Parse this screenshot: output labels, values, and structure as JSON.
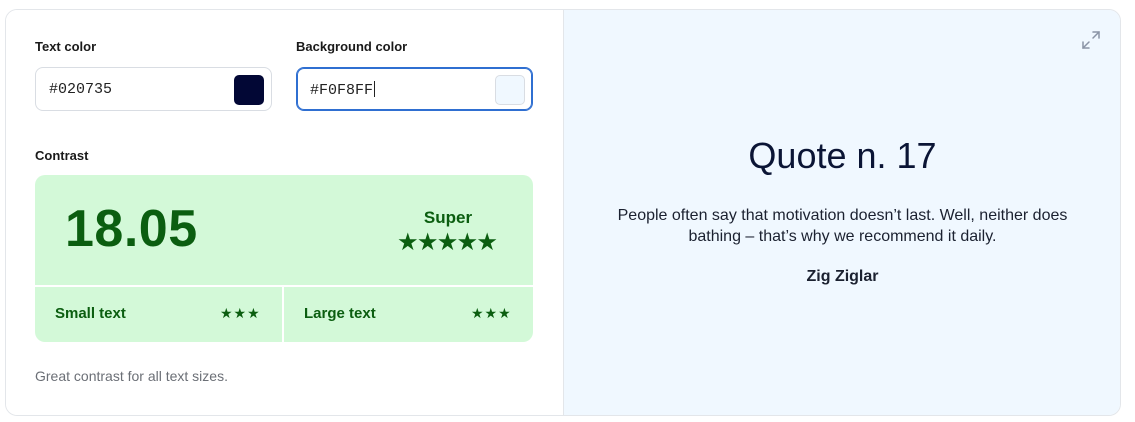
{
  "text_color": {
    "label": "Text color",
    "value": "#020735",
    "swatch": "#020735"
  },
  "background_color": {
    "label": "Background color",
    "value": "#F0F8FF",
    "swatch": "#F0F8FF"
  },
  "contrast": {
    "label": "Contrast",
    "score": "18.05",
    "rating": "Super",
    "rating_stars": 5,
    "small_text": {
      "label": "Small text",
      "stars": 3
    },
    "large_text": {
      "label": "Large text",
      "stars": 3
    },
    "note": "Great contrast for all text sizes."
  },
  "preview": {
    "title": "Quote n. 17",
    "text": "People often say that motivation doesn’t last. Well, neither does bathing – that’s why we recommend it daily.",
    "author": "Zig Ziglar",
    "expand_icon": "expand-icon"
  },
  "colors": {
    "panel_bg": "#F0F8FF",
    "contrast_bg": "#D3F9D8",
    "contrast_fg": "#0B5E10",
    "focus_border": "#2F6FD1"
  }
}
